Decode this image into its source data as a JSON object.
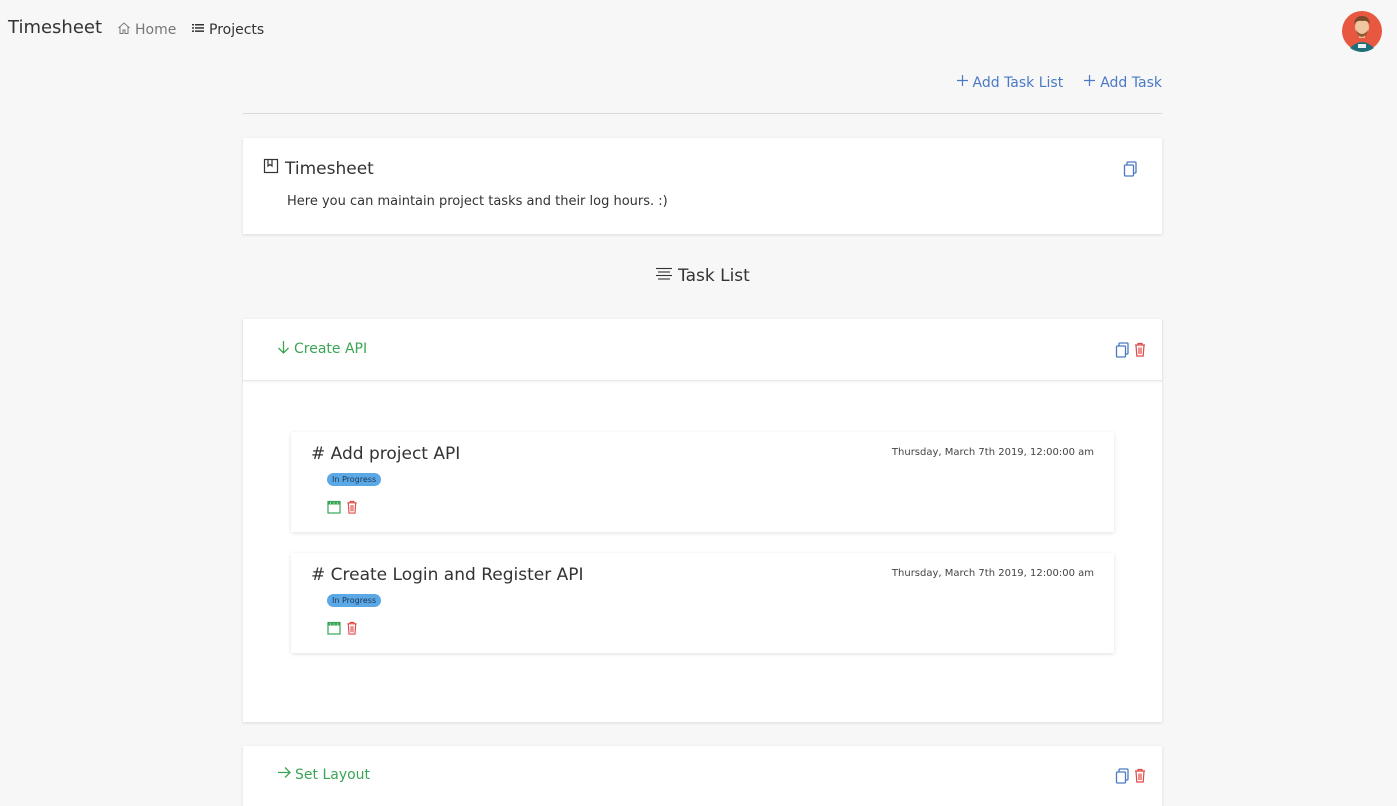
{
  "nav": {
    "brand": "Timesheet",
    "home": "Home",
    "projects": "Projects"
  },
  "actions": {
    "add_task_list": "Add Task List",
    "add_task": "Add Task"
  },
  "project": {
    "title": "Timesheet",
    "description": "Here you can maintain project tasks and their log hours. :)"
  },
  "section": {
    "title": "Task List"
  },
  "task_lists": [
    {
      "name": "Create API",
      "tasks": [
        {
          "title": "# Add project API",
          "date": "Thursday, March 7th 2019, 12:00:00 am",
          "status": "In Progress"
        },
        {
          "title": "# Create Login and Register API",
          "date": "Thursday, March 7th 2019, 12:00:00 am",
          "status": "In Progress"
        }
      ]
    },
    {
      "name": "Set Layout"
    }
  ],
  "colors": {
    "accent_blue": "#4a7ac4",
    "green": "#3aa556",
    "red": "#e04848",
    "badge": "#5ba8e6"
  }
}
